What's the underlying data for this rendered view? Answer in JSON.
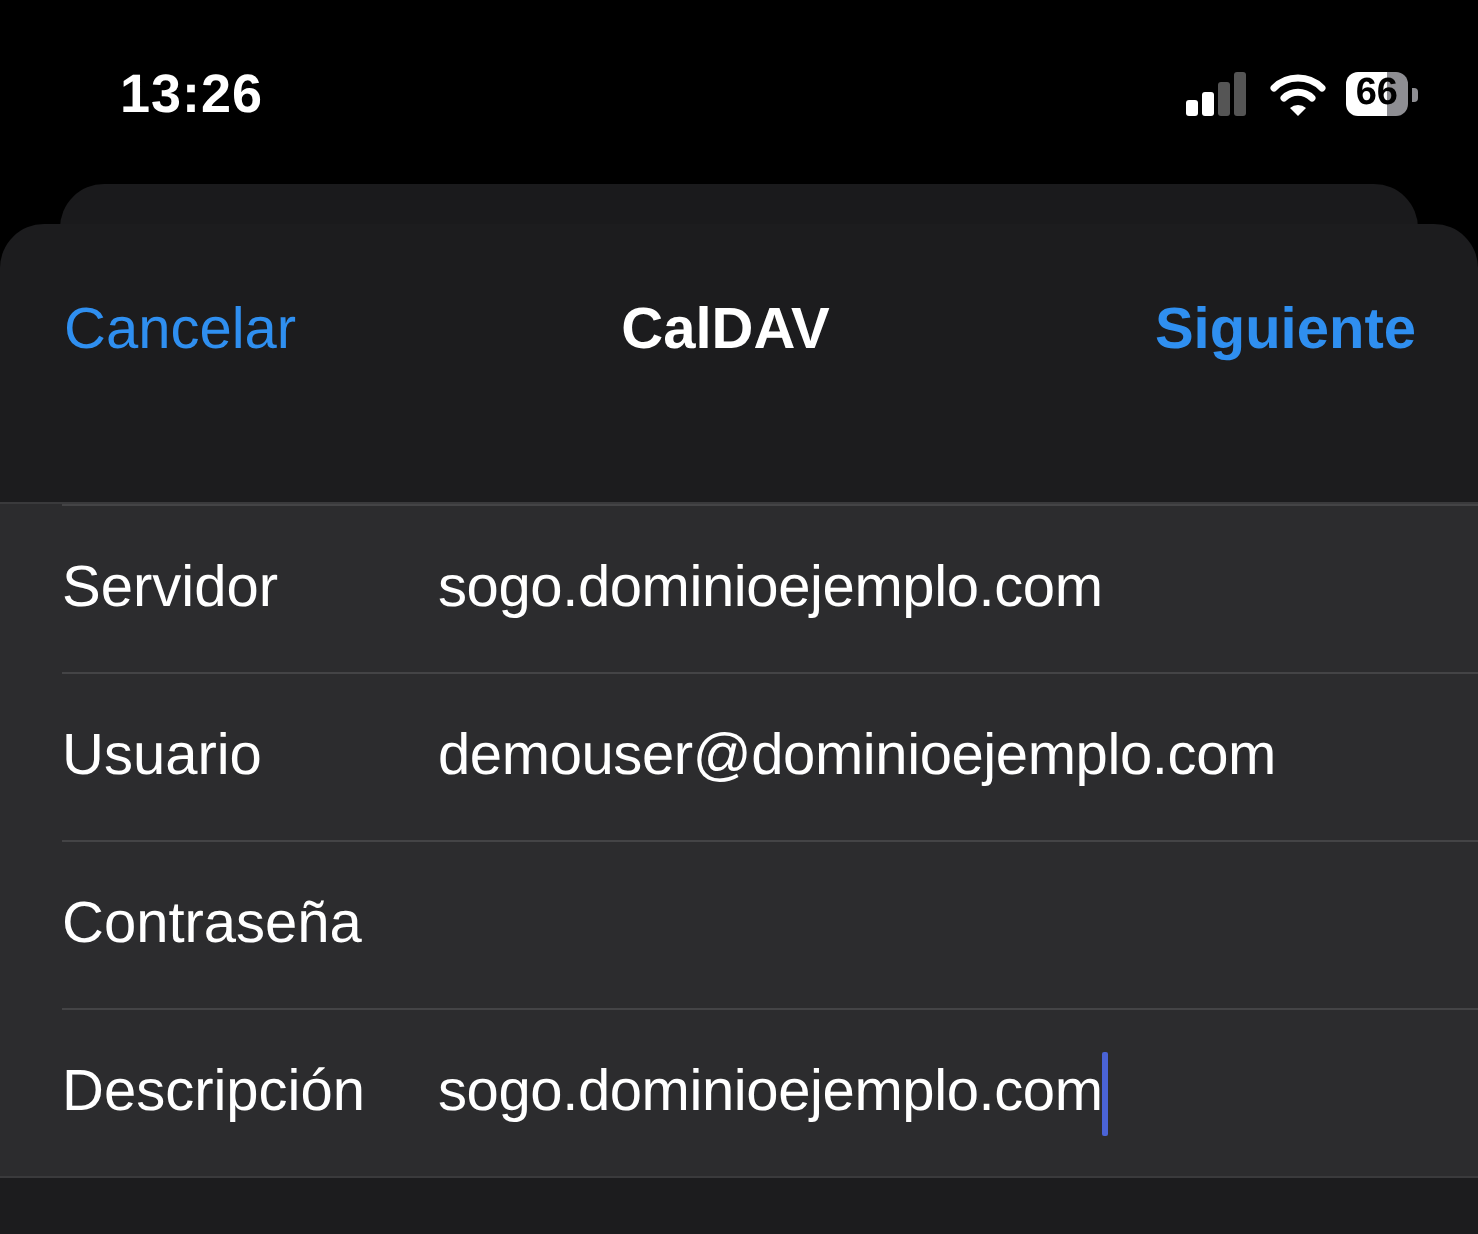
{
  "status_bar": {
    "time": "13:26",
    "battery": "66"
  },
  "nav_bar": {
    "cancel": "Cancelar",
    "title": "CalDAV",
    "next": "Siguiente"
  },
  "fields": [
    {
      "label": "Servidor",
      "value": "sogo.dominioejemplo.com",
      "focused": false
    },
    {
      "label": "Usuario",
      "value": "demouser@dominioejemplo.com",
      "focused": false
    },
    {
      "label": "Contraseña",
      "focused": false
    },
    {
      "label": "Descripción",
      "value": "sogo.dominioejemplo.com",
      "focused": true
    }
  ]
}
